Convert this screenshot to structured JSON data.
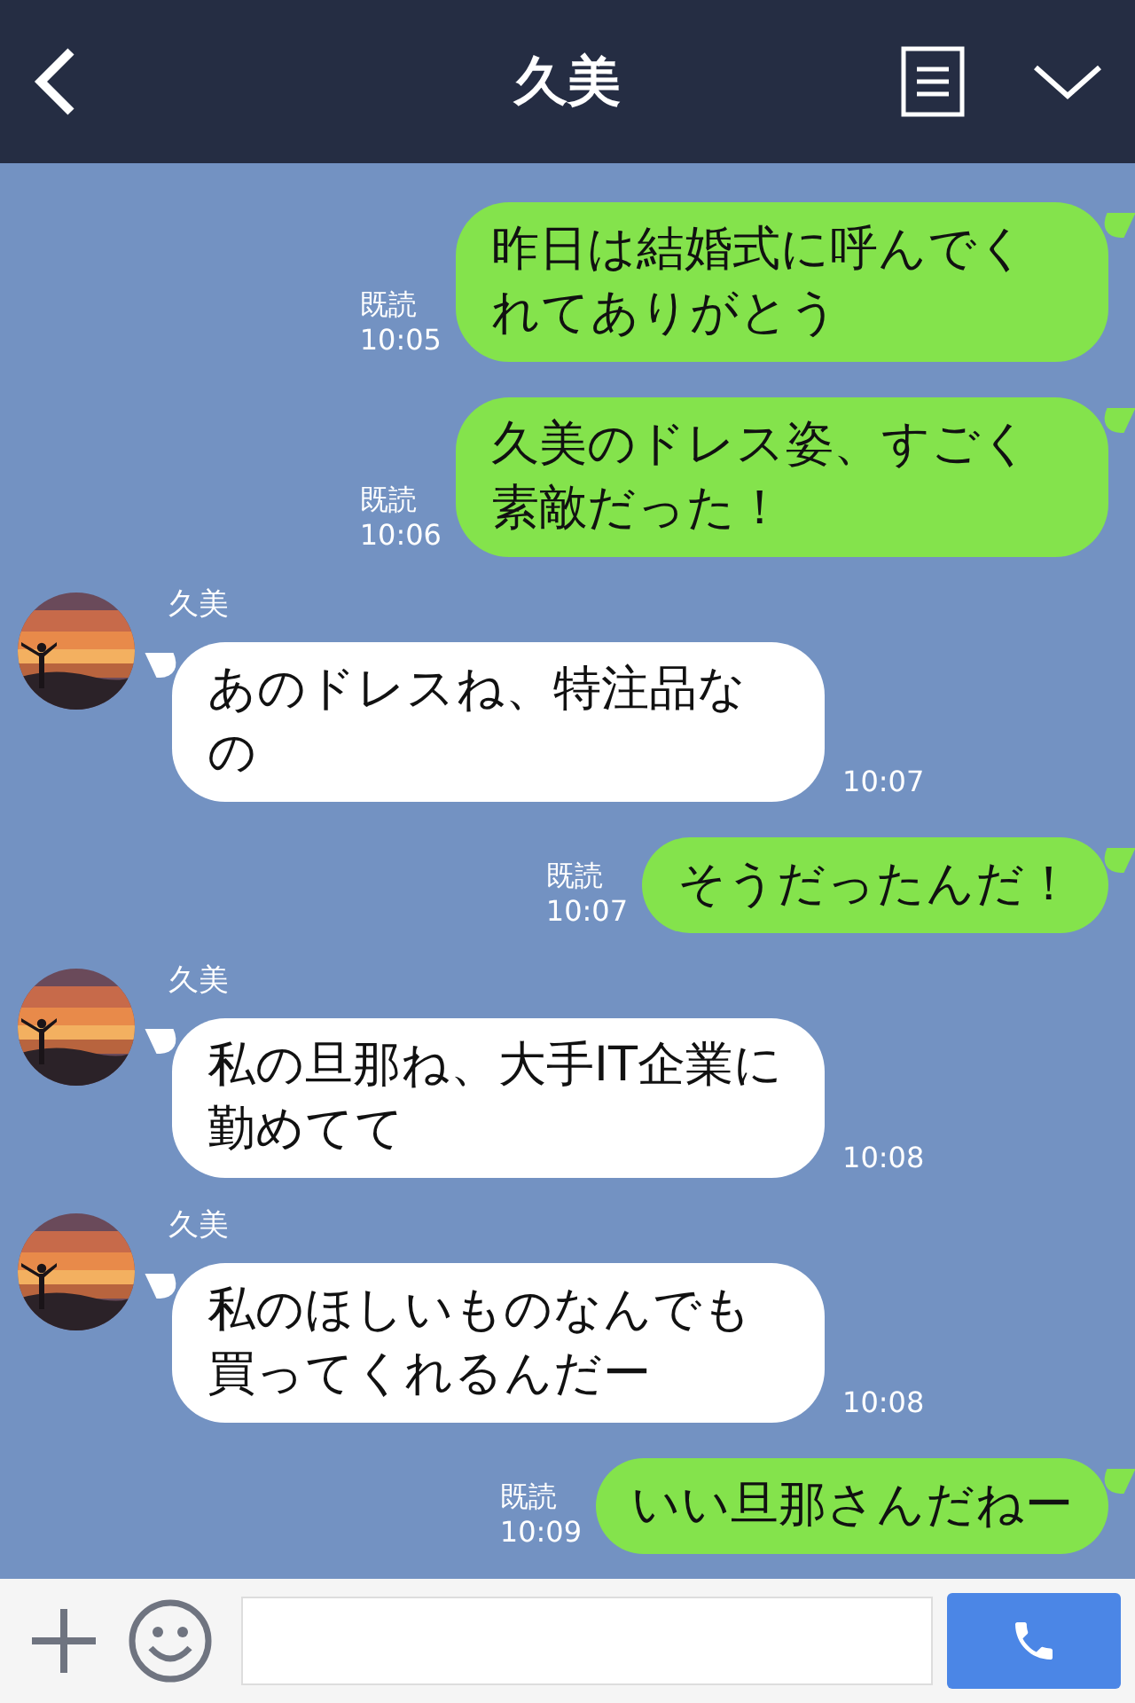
{
  "header": {
    "title": "久美"
  },
  "messages": [
    {
      "kind": "out",
      "text": "昨日は結婚式に呼んでくれてありがとう",
      "read": "既読",
      "time": "10:05"
    },
    {
      "kind": "out",
      "text": "久美のドレス姿、すごく素敵だった！",
      "read": "既読",
      "time": "10:06"
    },
    {
      "kind": "in",
      "sender": "久美",
      "text": "あのドレスね、特注品なの",
      "time": "10:07"
    },
    {
      "kind": "out",
      "text": "そうだったんだ！",
      "read": "既読",
      "time": "10:07"
    },
    {
      "kind": "in",
      "sender": "久美",
      "text": "私の旦那ね、大手IT企業に勤めてて",
      "time": "10:08"
    },
    {
      "kind": "in",
      "sender": "久美",
      "text": "私のほしいものなんでも買ってくれるんだー",
      "time": "10:08"
    },
    {
      "kind": "out",
      "text": "いい旦那さんだねー",
      "read": "既読",
      "time": "10:09"
    }
  ]
}
